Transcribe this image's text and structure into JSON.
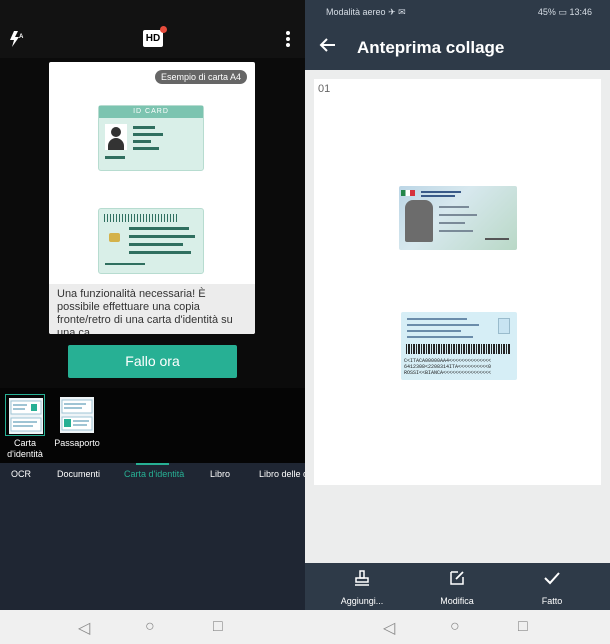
{
  "left_screen": {
    "toolbar": {
      "flash_icon": "flash-auto-icon",
      "hd_label": "HD",
      "menu_icon": "more-vert-icon"
    },
    "example_card": {
      "badge": "Esempio di carta A4",
      "front_header": "ID CARD",
      "message": "Una funzionalità necessaria! È possibile effettuare una copia fronte/retro di una carta d'identità su una ca..."
    },
    "cta_label": "Fallo ora",
    "modes": [
      {
        "label": "Carta d'identità",
        "selected": true
      },
      {
        "label": "Passaporto",
        "selected": false
      }
    ],
    "tabs": [
      {
        "label": "OCR"
      },
      {
        "label": "Documenti"
      },
      {
        "label": "Carta d'identità",
        "active": true
      },
      {
        "label": "Libro"
      },
      {
        "label": "Libro delle d"
      }
    ]
  },
  "right_screen": {
    "status_bar": {
      "left": "Modalità aereo",
      "battery": "45%",
      "time": "13:46"
    },
    "appbar": {
      "title": "Anteprima collage",
      "back_icon": "arrow-back-icon"
    },
    "page": {
      "number": "01",
      "mrz_lines": [
        "C<ITACA00000AA4<<<<<<<<<<<<<<",
        "6412308<2208314ITA<<<<<<<<<<0",
        "ROSSI<<BIANCA<<<<<<<<<<<<<<<<"
      ]
    },
    "bottom_actions": [
      {
        "label": "Aggiungi...",
        "icon": "stamp-icon"
      },
      {
        "label": "Modifica",
        "icon": "edit-icon"
      },
      {
        "label": "Fatto",
        "icon": "check-icon"
      }
    ]
  },
  "colors": {
    "accent": "#27b094",
    "appbar": "#2e3a48",
    "tabbar": "#1f2633"
  }
}
